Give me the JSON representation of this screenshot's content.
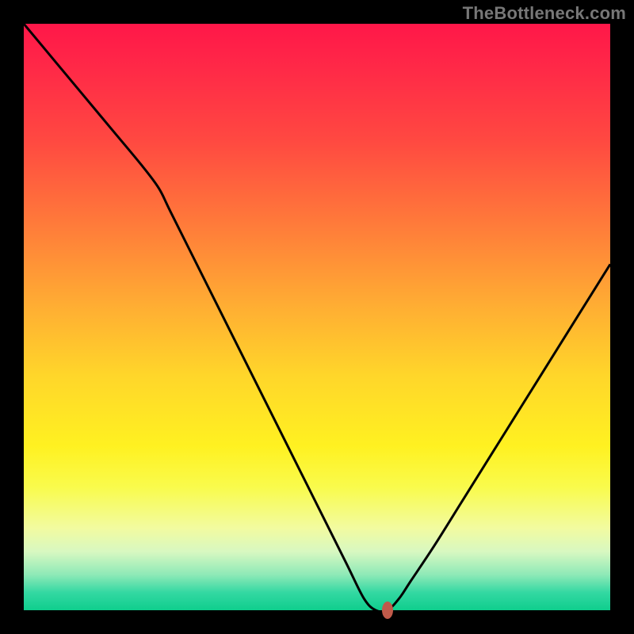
{
  "attribution": "TheBottleneck.com",
  "colors": {
    "page_bg": "#000000",
    "curve": "#000000",
    "marker": "#c05a4a",
    "attribution_text": "#777777"
  },
  "chart_data": {
    "type": "line",
    "title": "",
    "xlabel": "",
    "ylabel": "",
    "xlim": [
      0,
      100
    ],
    "ylim": [
      0,
      100
    ],
    "x": [
      0,
      5,
      10,
      15,
      20,
      23,
      25,
      30,
      35,
      40,
      45,
      50,
      55,
      58,
      60,
      62,
      64,
      66,
      70,
      75,
      80,
      85,
      90,
      95,
      100
    ],
    "values": [
      100,
      94,
      88,
      82,
      76,
      72,
      68,
      58,
      48,
      38,
      28,
      18,
      8,
      2,
      0,
      0,
      2,
      5,
      11,
      19,
      27,
      35,
      43,
      51,
      59
    ],
    "marker": {
      "x": 62,
      "y": 0
    },
    "grid": false,
    "legend": null
  }
}
